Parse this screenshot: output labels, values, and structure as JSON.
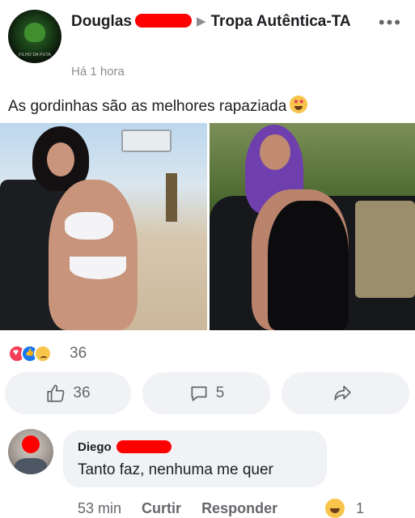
{
  "post": {
    "author_name": "Douglas",
    "group_name": "Tropa Autêntica-TA",
    "more_icon": "more-horizontal-icon",
    "avatar_caption": "FILHO DA PUTA",
    "time": "Há 1 hora",
    "text": "As gordinhas são as melhores rapaziada",
    "text_emoji": "star-struck-emoji"
  },
  "reactions": {
    "types": [
      "love",
      "like",
      "sad"
    ],
    "count": "36"
  },
  "actions": {
    "like_count": "36",
    "comment_count": "5",
    "like_icon": "thumbs-up-icon",
    "comment_icon": "comment-bubble-icon",
    "share_icon": "share-arrow-icon"
  },
  "comment": {
    "author_name": "Diego",
    "text": "Tanto faz, nenhuma me quer",
    "time": "53 min",
    "like_label": "Curtir",
    "reply_label": "Responder",
    "reaction": "haha",
    "reaction_count": "1"
  },
  "colors": {
    "redaction": "#ff0000",
    "pill_background": "#f0f2f5",
    "secondary_text": "#65676b"
  }
}
